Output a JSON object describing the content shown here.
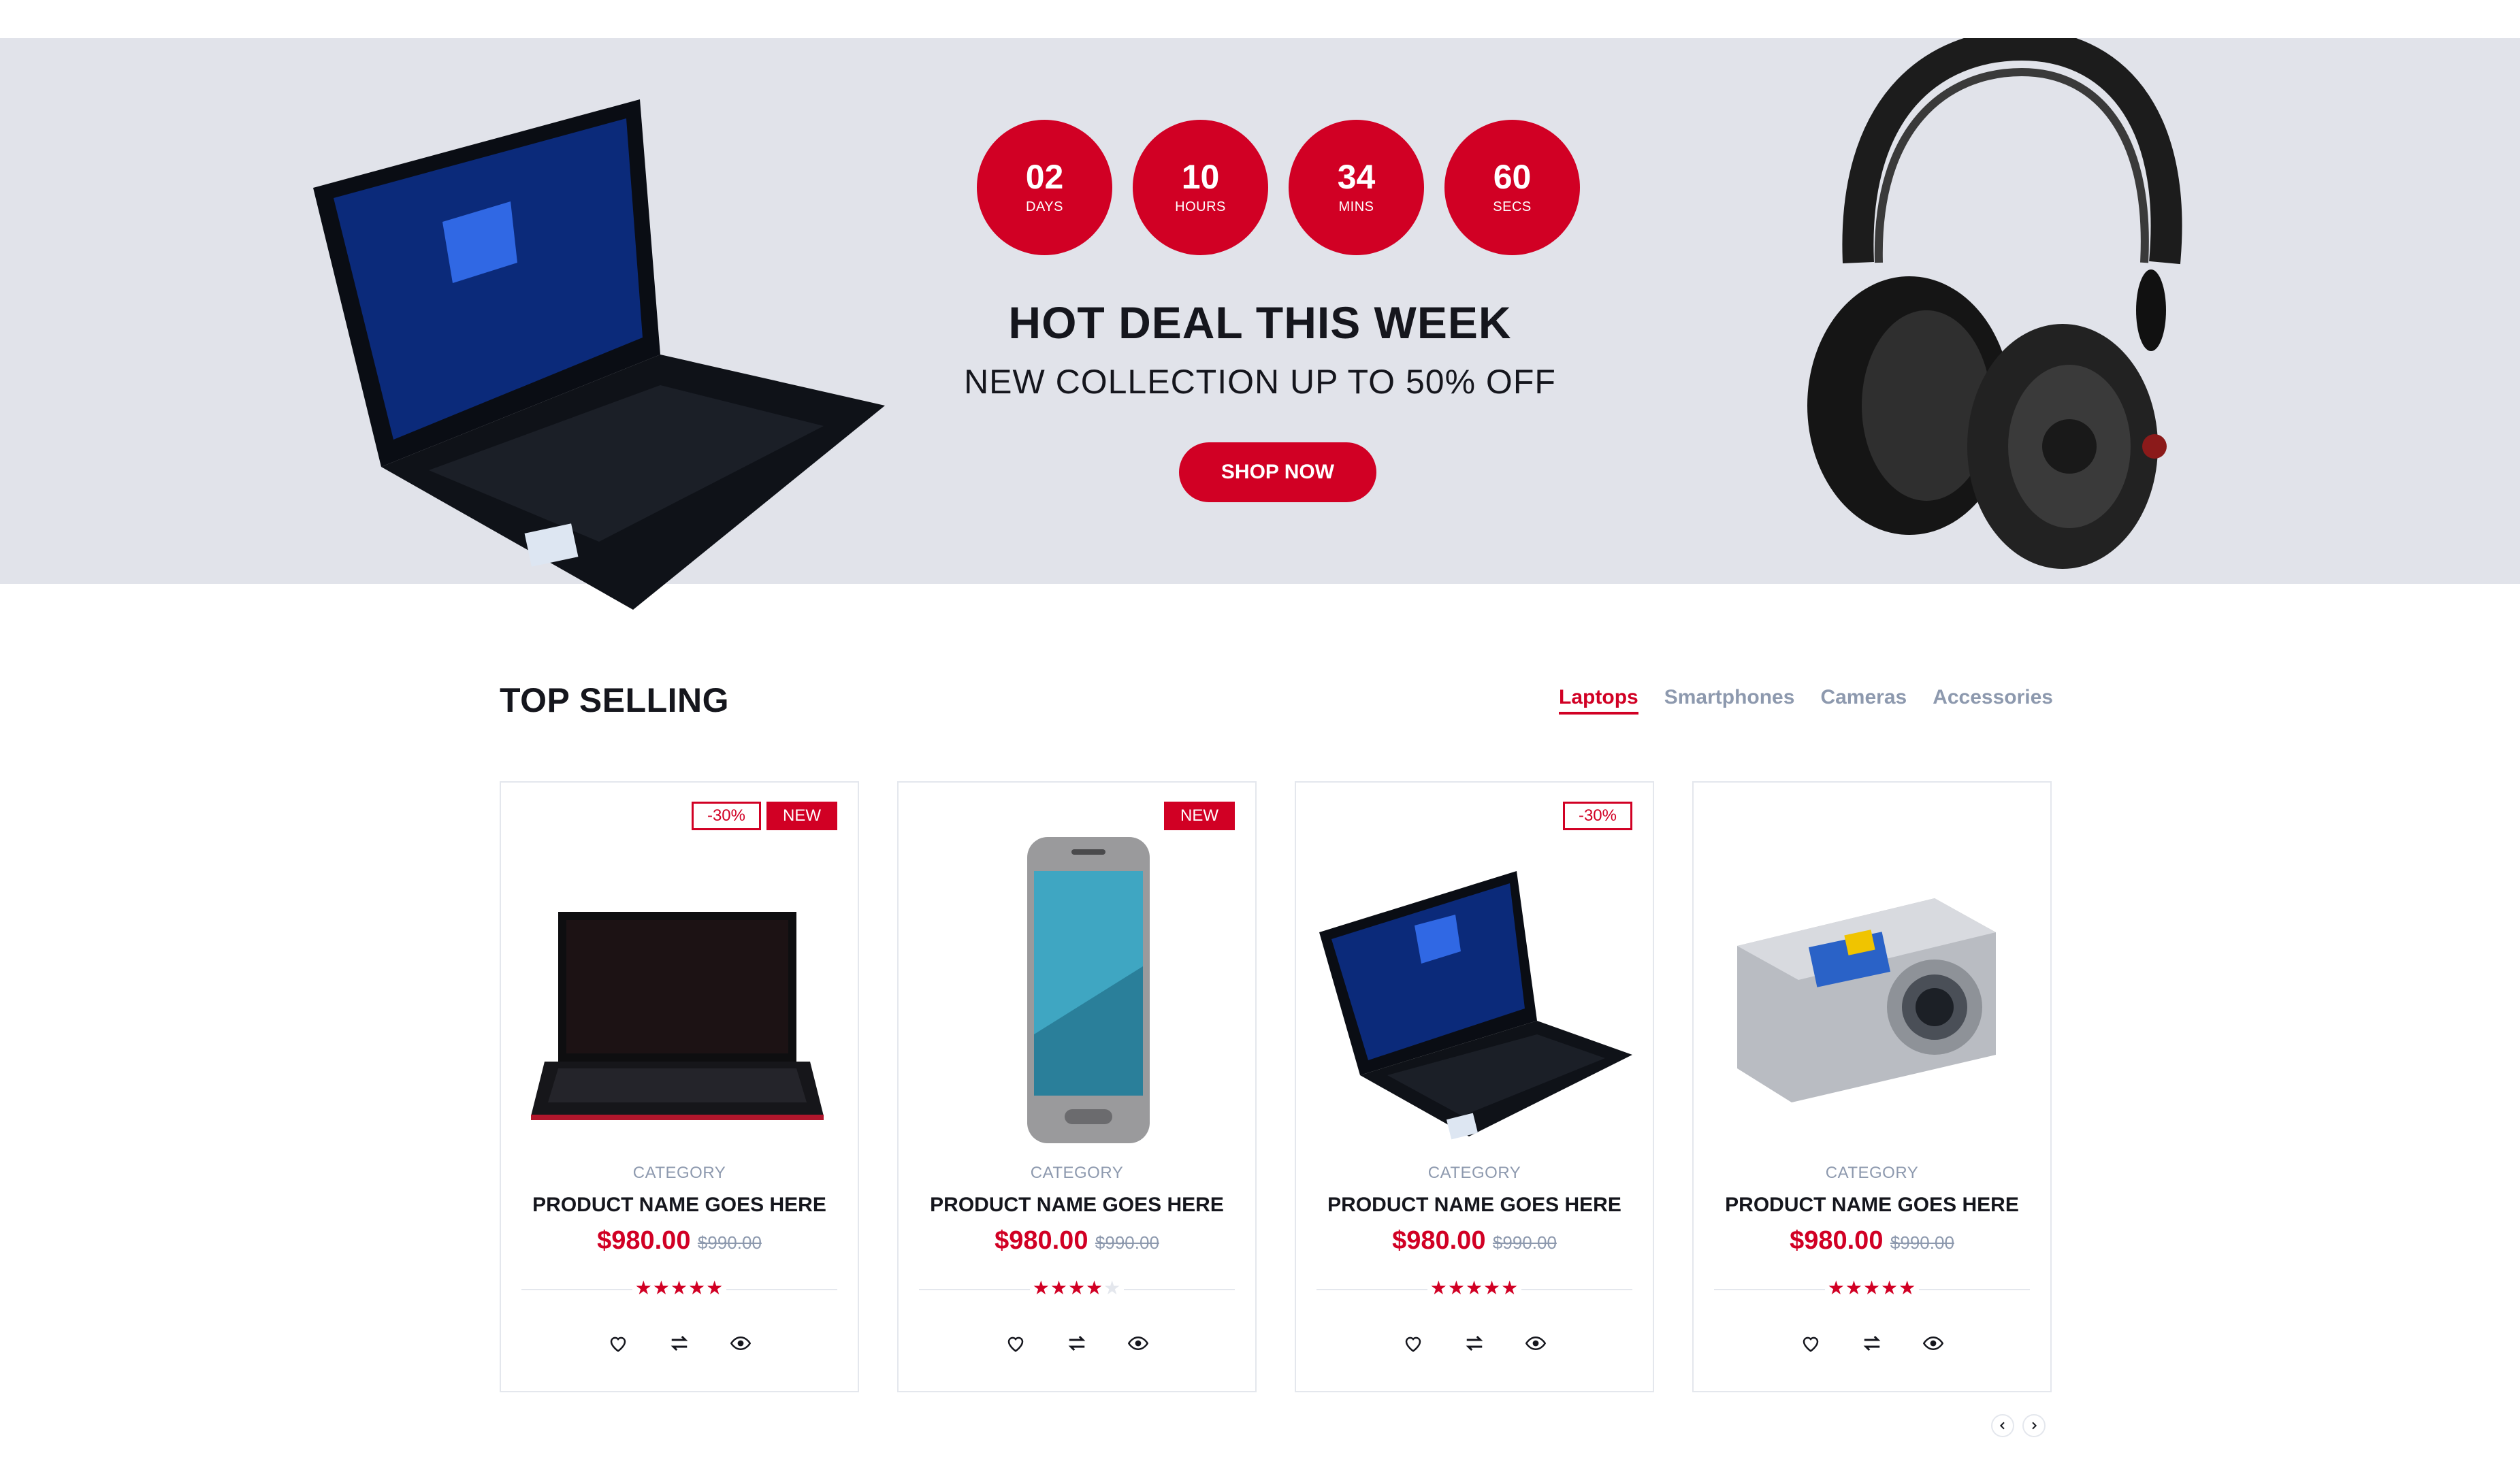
{
  "banner": {
    "countdown": [
      {
        "value": "02",
        "label": "DAYS"
      },
      {
        "value": "10",
        "label": "HOURS"
      },
      {
        "value": "34",
        "label": "MINS"
      },
      {
        "value": "60",
        "label": "SECS"
      }
    ],
    "title": "HOT DEAL THIS WEEK",
    "subtitle": "NEW COLLECTION UP TO 50% OFF",
    "cta": "SHOP NOW",
    "images": [
      "laptop",
      "headphones"
    ]
  },
  "top_selling": {
    "title": "TOP SELLING",
    "tabs": [
      {
        "label": "Laptops",
        "active": true
      },
      {
        "label": "Smartphones",
        "active": false
      },
      {
        "label": "Cameras",
        "active": false
      },
      {
        "label": "Accessories",
        "active": false
      }
    ],
    "products": [
      {
        "image": "laptop-black-red",
        "sale": "-30%",
        "new": "NEW",
        "category": "CATEGORY",
        "name": "PRODUCT NAME GOES HERE",
        "price": "$980.00",
        "old_price": "$990.00",
        "rating": 5
      },
      {
        "image": "smartphone",
        "sale": "",
        "new": "NEW",
        "category": "CATEGORY",
        "name": "PRODUCT NAME GOES HERE",
        "price": "$980.00",
        "old_price": "$990.00",
        "rating": 4
      },
      {
        "image": "laptop-asus",
        "sale": "-30%",
        "new": "",
        "category": "CATEGORY",
        "name": "PRODUCT NAME GOES HERE",
        "price": "$980.00",
        "old_price": "$990.00",
        "rating": 5
      },
      {
        "image": "camera",
        "sale": "",
        "new": "",
        "category": "CATEGORY",
        "name": "PRODUCT NAME GOES HERE",
        "price": "$980.00",
        "old_price": "$990.00",
        "rating": 5
      }
    ],
    "icons": [
      "heart-icon",
      "exchange-icon",
      "eye-icon",
      "chevron-left-icon",
      "chevron-right-icon"
    ]
  },
  "colors": {
    "accent": "#d10024",
    "banner_bg": "#e1e3ea",
    "dark": "#15161d",
    "muted": "#8d99ae"
  }
}
